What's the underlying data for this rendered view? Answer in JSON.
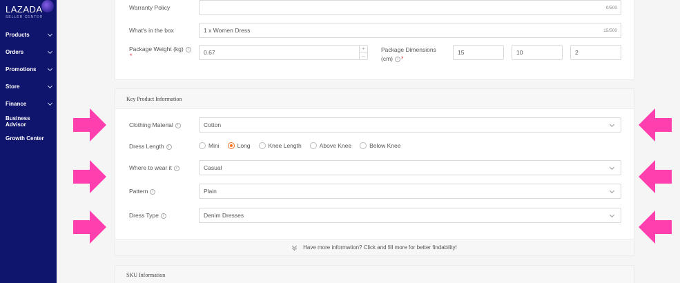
{
  "brand": {
    "name": "LAZADA",
    "subtitle": "SELLER CENTER"
  },
  "sidebar": {
    "items": [
      {
        "label": "Products",
        "has_chevron": true
      },
      {
        "label": "Orders",
        "has_chevron": true
      },
      {
        "label": "Promotions",
        "has_chevron": true
      },
      {
        "label": "Store",
        "has_chevron": true
      },
      {
        "label": "Finance",
        "has_chevron": true
      },
      {
        "label": "Business Advisor",
        "has_chevron": false
      },
      {
        "label": "Growth Center",
        "has_chevron": false
      }
    ]
  },
  "top_form": {
    "warranty_policy": {
      "label": "Warranty Policy",
      "value": "",
      "counter": "0/500"
    },
    "whats_in_box": {
      "label": "What's in the box",
      "value": "1 x Women Dress",
      "counter": "15/500"
    },
    "package_weight": {
      "label": "Package Weight (kg)",
      "value": "0.67",
      "required": "*",
      "plus": "+",
      "minus": "−"
    },
    "package_dimensions": {
      "label_line1": "Package Dimensions",
      "label_line2": "(cm)",
      "required": "*",
      "length": "15",
      "width": "10",
      "height": "2"
    }
  },
  "key_info": {
    "title": "Key Product Information",
    "clothing_material": {
      "label": "Clothing Material",
      "value": "Cotton"
    },
    "dress_length": {
      "label": "Dress Length",
      "options": [
        "Mini",
        "Long",
        "Knee Length",
        "Above Knee",
        "Below Knee"
      ],
      "selected": "Long"
    },
    "where_to_wear": {
      "label": "Where to wear it",
      "value": "Casual"
    },
    "pattern": {
      "label": "Pattern",
      "value": "Plain"
    },
    "dress_type": {
      "label": "Dress Type",
      "value": "Denim Dresses"
    },
    "more_info": "Have more information? Click and fill more for better findability!"
  },
  "sku": {
    "title": "SKU Information"
  },
  "colors": {
    "sidebar": "#0f146d",
    "accent": "#f57224",
    "arrow": "#ff3fae",
    "required": "#e4393c"
  },
  "icons": {
    "info": "i"
  }
}
